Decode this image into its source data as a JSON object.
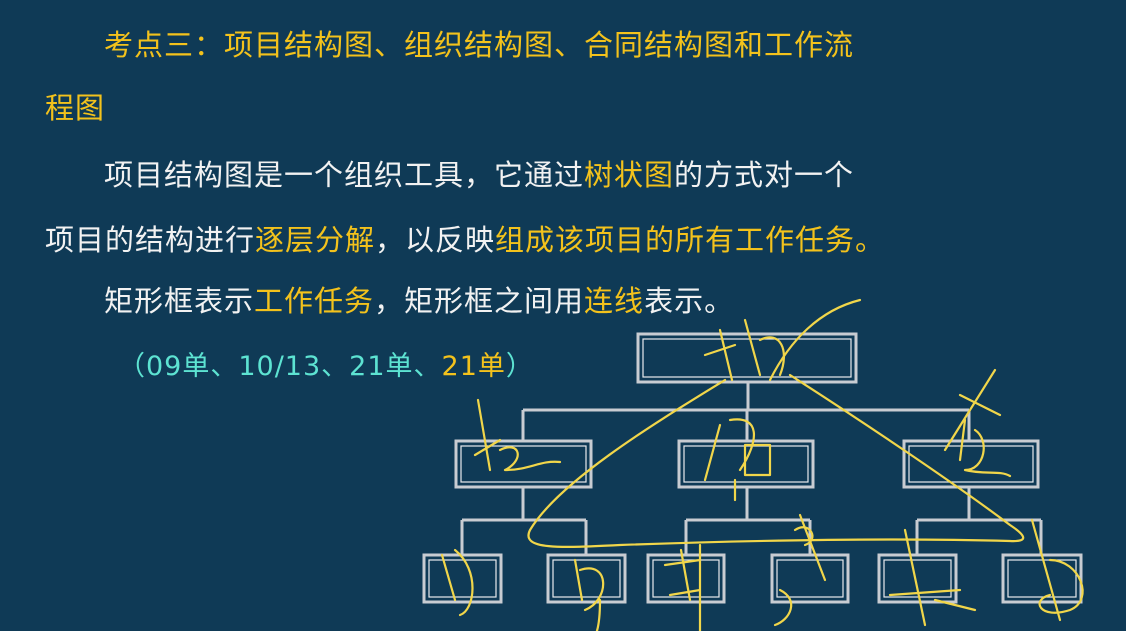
{
  "slide": {
    "heading_line1": "考点三：项目结构图、组织结构图、合同结构图和工作流",
    "heading_line2": "程图",
    "para1": {
      "part1": "项目结构图是一个组织工具，它通过",
      "highlight1": "树状图",
      "part2": "的方式对一个"
    },
    "para1_line2": {
      "part1": "项目的结构进行",
      "highlight1": "逐层分解",
      "part2": "，以反映",
      "highlight2": "组成该项目的所有工作任务。"
    },
    "para2": {
      "part1": "矩形框表示",
      "highlight1": "工作任务",
      "part2": "，矩形框之间用",
      "highlight2": "连线",
      "part3": "表示。"
    },
    "references": {
      "cyan_part": "（09单、10/13、21单、",
      "yellow_part": "21单",
      "close": "）"
    }
  },
  "colors": {
    "background": "#0f3a56",
    "highlight": "#f3c21c",
    "reference": "#5de3d2",
    "text": "#f2f2f2",
    "handwriting": "#f1d64a"
  },
  "diagram": {
    "type": "tree",
    "levels": [
      1,
      3,
      6
    ],
    "box_labels": []
  }
}
